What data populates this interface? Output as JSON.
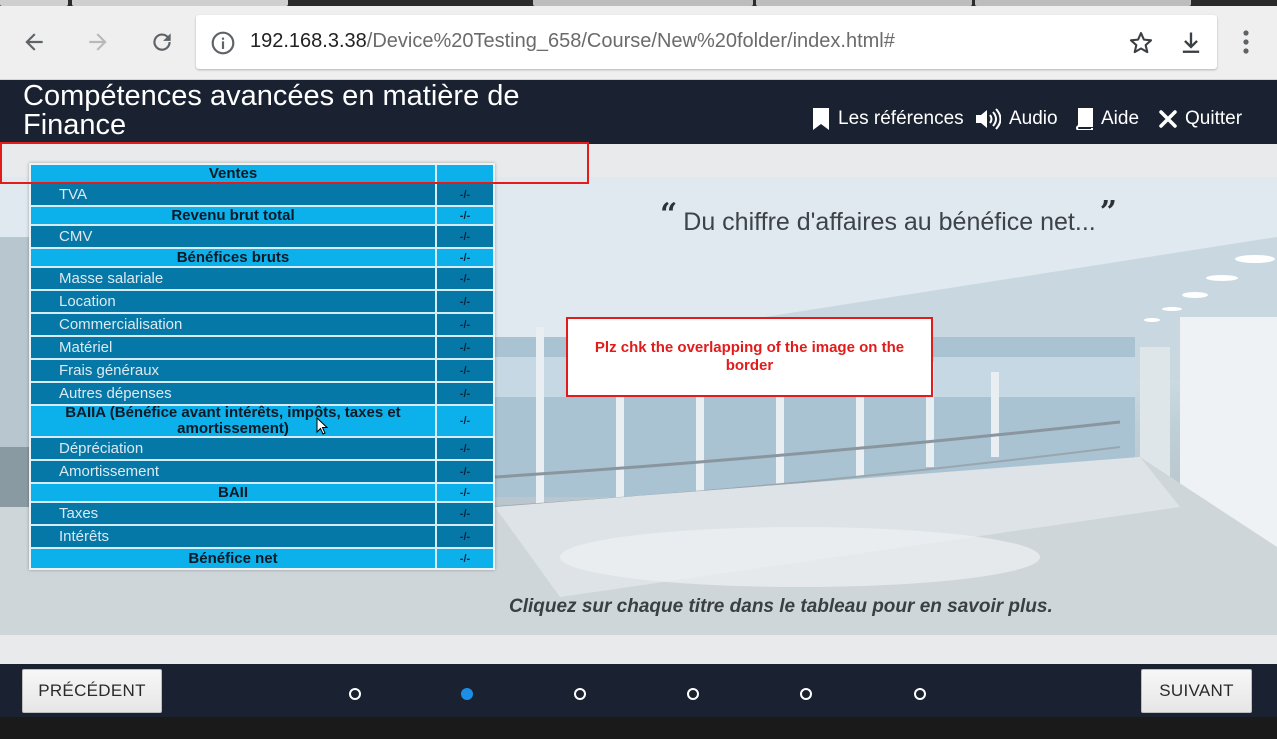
{
  "browser": {
    "url_host": "192.168.3.38",
    "url_path": "/Device%20Testing_658/Course/New%20folder/index.html#"
  },
  "course": {
    "title": "Compétences avancées en matière de Finance",
    "header_links": [
      {
        "label": "Les références",
        "icon": "bookmark-icon"
      },
      {
        "label": "Audio",
        "icon": "speaker-icon"
      },
      {
        "label": "Aide",
        "icon": "book-icon"
      },
      {
        "label": "Quitter",
        "icon": "close-icon"
      }
    ]
  },
  "content": {
    "quote_text": "Du chiffre d'affaires au bénéfice net...",
    "quote_open": "“",
    "quote_close": "”",
    "instruction": "Cliquez sur chaque titre dans le tableau pour en savoir plus.",
    "table_rows": [
      {
        "label": "Ventes",
        "kind": "total",
        "op": ""
      },
      {
        "label": "TVA",
        "kind": "item",
        "op": "-/-"
      },
      {
        "label": "Revenu brut total",
        "kind": "total",
        "op": "-/-"
      },
      {
        "label": "CMV",
        "kind": "item",
        "op": "-/-"
      },
      {
        "label": "Bénéfices bruts",
        "kind": "total",
        "op": "-/-"
      },
      {
        "label": "Masse salariale",
        "kind": "item",
        "op": "-/-"
      },
      {
        "label": "Location",
        "kind": "item",
        "op": "-/-"
      },
      {
        "label": "Commercialisation",
        "kind": "item",
        "op": "-/-"
      },
      {
        "label": "Matériel",
        "kind": "item",
        "op": "-/-"
      },
      {
        "label": "Frais généraux",
        "kind": "item",
        "op": "-/-"
      },
      {
        "label": "Autres dépenses",
        "kind": "item",
        "op": "-/-"
      },
      {
        "label": "BAIIA (Bénéfice avant intérêts, impôts, taxes et amortissement)",
        "kind": "total",
        "op": "-/-"
      },
      {
        "label": "Dépréciation",
        "kind": "item",
        "op": "-/-"
      },
      {
        "label": "Amortissement",
        "kind": "item",
        "op": "-/-"
      },
      {
        "label": "BAII",
        "kind": "total",
        "op": "-/-"
      },
      {
        "label": "Taxes",
        "kind": "item",
        "op": "-/-"
      },
      {
        "label": "Intérêts",
        "kind": "item",
        "op": "-/-"
      },
      {
        "label": "Bénéfice net",
        "kind": "total",
        "op": "-/-"
      }
    ]
  },
  "annotation": {
    "note": "Plz chk the overlapping of the image on the border"
  },
  "footer": {
    "prev_label": "PRÉCÉDENT",
    "next_label": "SUIVANT",
    "page_count": 6,
    "active_page": 2
  },
  "colors": {
    "header_bg": "#1a2231",
    "row_item": "#0578a8",
    "row_total": "#0cb0ea",
    "annotation_red": "#e21b1b",
    "active_dot": "#1d8ee6"
  }
}
